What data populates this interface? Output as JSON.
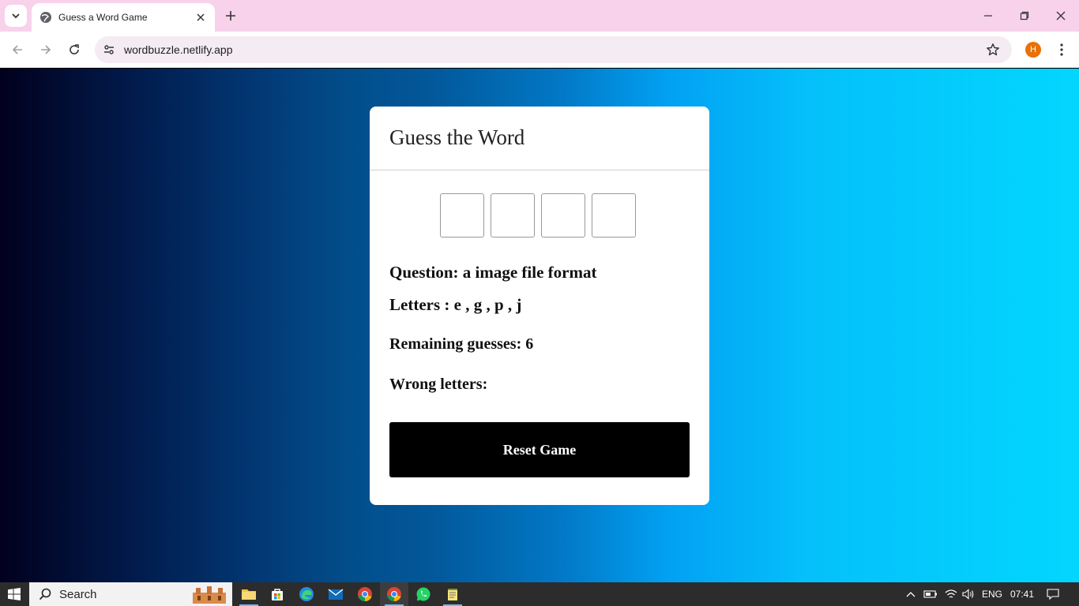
{
  "browser": {
    "tab_title": "Guess a Word Game",
    "url": "wordbuzzle.netlify.app",
    "profile_initial": "H"
  },
  "game": {
    "title": "Guess the Word",
    "slots": [
      "",
      "",
      "",
      ""
    ],
    "question": "Question: a image file format",
    "letters": "Letters : e , g , p , j",
    "remaining": "Remaining guesses: 6",
    "wrong": "Wrong letters:",
    "reset_label": "Reset Game"
  },
  "taskbar": {
    "search_label": "Search",
    "language": "ENG",
    "time": "07:41"
  },
  "colors": {
    "tabbar": "#f7d2ea",
    "card": "#ffffff",
    "button": "#000000",
    "avatar": "#e8710a"
  }
}
